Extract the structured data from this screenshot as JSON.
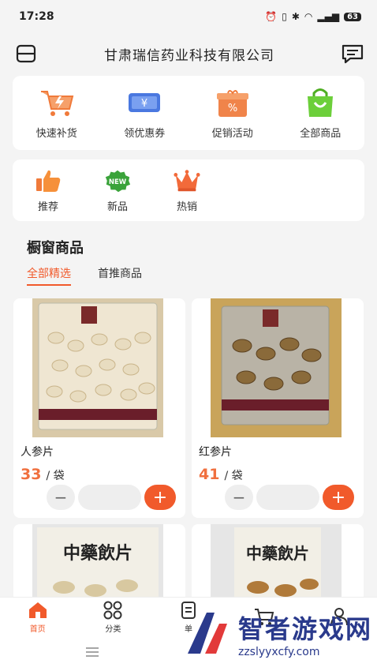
{
  "status": {
    "time": "17:28",
    "battery": "63"
  },
  "header": {
    "title": "甘肃瑞信药业科技有限公司"
  },
  "quick_actions": [
    {
      "label": "快速补货"
    },
    {
      "label": "领优惠券"
    },
    {
      "label": "促销活动"
    },
    {
      "label": "全部商品"
    }
  ],
  "tags": [
    {
      "label": "推荐"
    },
    {
      "label": "新品",
      "badge": "NEW"
    },
    {
      "label": "热销"
    }
  ],
  "section": {
    "title": "橱窗商品"
  },
  "tabs": [
    {
      "label": "全部精选",
      "active": true
    },
    {
      "label": "首推商品",
      "active": false
    }
  ],
  "products": [
    {
      "name": "人参片",
      "price": "33",
      "unit": "/ 袋"
    },
    {
      "name": "红参片",
      "price": "41",
      "unit": "/ 袋"
    },
    {
      "package_text": "中藥飲片"
    },
    {
      "package_text": "中藥飲片"
    }
  ],
  "tabbar": [
    {
      "label": "首页",
      "active": true
    },
    {
      "label": "分类",
      "active": false
    },
    {
      "label": "单",
      "active": false
    },
    {
      "label": "",
      "active": false
    },
    {
      "label": "",
      "active": false
    }
  ],
  "watermark": {
    "title": "智者游戏网",
    "url": "zzslyyxcfy.com"
  },
  "colors": {
    "accent": "#f15a2b",
    "price": "#f0703f",
    "watermark": "#2a3a8c"
  }
}
